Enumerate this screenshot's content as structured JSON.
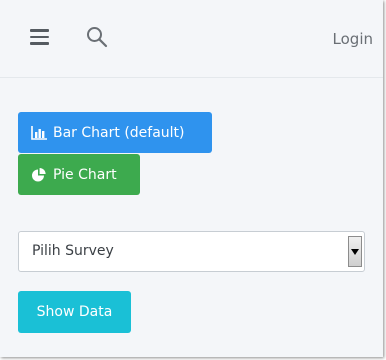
{
  "navbar": {
    "menu_icon": "hamburger-icon",
    "search_icon": "search-icon",
    "login_label": "Login"
  },
  "chart_buttons": {
    "bar": {
      "label": "Bar Chart (default)",
      "icon": "bar-chart-icon",
      "color": "#2f93ee"
    },
    "pie": {
      "label": "Pie Chart",
      "icon": "pie-chart-icon",
      "color": "#3daa4e"
    }
  },
  "survey_select": {
    "selected": "Pilih Survey",
    "icon": "dropdown-arrow-icon"
  },
  "show_button": {
    "label": "Show Data",
    "color": "#1ac0d6"
  }
}
